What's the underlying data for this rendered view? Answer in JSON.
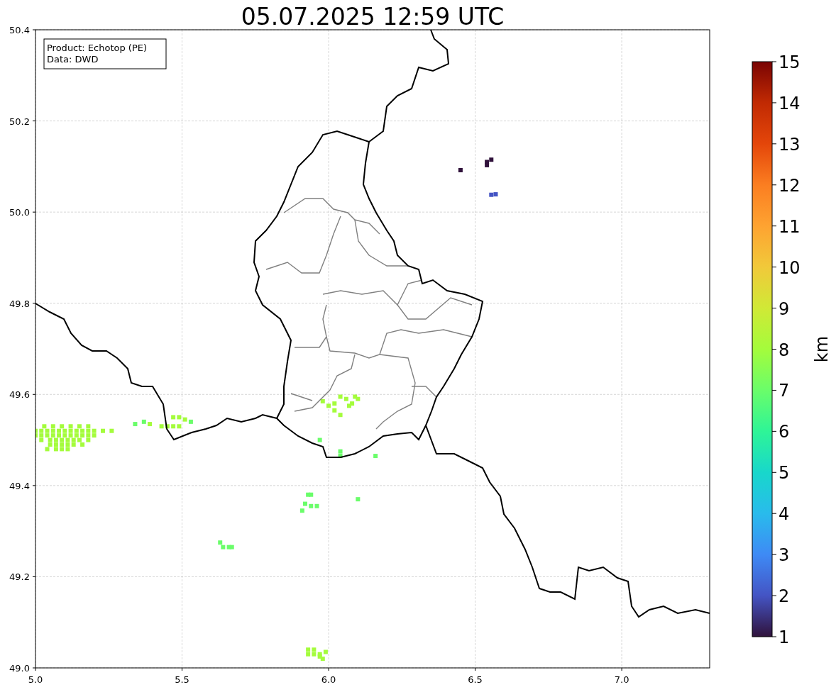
{
  "title": "05.07.2025 12:59 UTC",
  "info_box": {
    "lines": [
      "Product: Echotop (PE)",
      "Data: DWD"
    ]
  },
  "map": {
    "chart_data": {
      "type": "scatter",
      "grid": true,
      "xlim": [
        5.0,
        7.3
      ],
      "ylim": [
        49.0,
        50.4
      ],
      "xticks": [
        {
          "value": 5.0,
          "label": "5.0"
        },
        {
          "value": 5.5,
          "label": "5.5"
        },
        {
          "value": 6.0,
          "label": "6.0"
        },
        {
          "value": 6.5,
          "label": "6.5"
        },
        {
          "value": 7.0,
          "label": "7.0"
        }
      ],
      "yticks": [
        {
          "value": 49.0,
          "label": "49.0"
        },
        {
          "value": 49.2,
          "label": "49.2"
        },
        {
          "value": 49.4,
          "label": "49.4"
        },
        {
          "value": 49.6,
          "label": "49.6"
        },
        {
          "value": 49.8,
          "label": "49.8"
        },
        {
          "value": 50.0,
          "label": "50.0"
        },
        {
          "value": 50.2,
          "label": "50.2"
        },
        {
          "value": 50.4,
          "label": "50.4"
        }
      ],
      "series": [
        {
          "color": "#a4fc3c",
          "x": [
            5.03,
            5.06,
            5.09,
            5.12,
            5.15,
            5.18,
            5.0,
            5.02,
            5.04,
            5.06,
            5.08,
            5.1,
            5.12,
            5.14,
            5.16,
            5.18,
            5.2,
            5.23,
            5.26,
            5.0,
            5.02,
            5.04,
            5.06,
            5.08,
            5.1,
            5.12,
            5.14,
            5.16,
            5.18,
            5.2,
            5.02,
            5.05,
            5.07,
            5.09,
            5.11,
            5.13,
            5.15,
            5.18,
            5.05,
            5.07,
            5.09,
            5.11,
            5.13,
            5.16,
            5.04,
            5.07,
            5.09,
            5.11,
            5.39,
            5.43,
            5.45,
            5.47,
            5.49,
            5.47,
            5.51,
            5.49,
            5.98,
            6.0,
            6.02,
            6.04,
            6.04,
            6.06,
            6.08,
            6.1,
            6.07,
            6.09,
            6.02,
            5.93,
            5.95,
            5.93,
            5.95,
            5.97,
            5.98,
            5.99,
            5.97
          ],
          "values": [
            49.53,
            49.53,
            49.53,
            49.53,
            49.53,
            49.53,
            49.52,
            49.52,
            49.52,
            49.52,
            49.52,
            49.52,
            49.52,
            49.52,
            49.52,
            49.52,
            49.52,
            49.52,
            49.52,
            49.51,
            49.51,
            49.51,
            49.51,
            49.51,
            49.51,
            49.51,
            49.51,
            49.51,
            49.51,
            49.51,
            49.5,
            49.5,
            49.5,
            49.5,
            49.5,
            49.5,
            49.5,
            49.5,
            49.49,
            49.49,
            49.49,
            49.49,
            49.49,
            49.49,
            49.48,
            49.48,
            49.48,
            49.48,
            49.535,
            49.53,
            49.53,
            49.55,
            49.55,
            49.53,
            49.545,
            49.53,
            49.585,
            49.575,
            49.565,
            49.555,
            49.595,
            49.59,
            49.58,
            49.59,
            49.575,
            49.595,
            49.58,
            49.04,
            49.04,
            49.03,
            49.03,
            49.03,
            49.02,
            49.035,
            49.025
          ]
        },
        {
          "color": "#6afd6a",
          "x": [
            5.34,
            5.37,
            5.53,
            5.97,
            6.04,
            6.04,
            6.16,
            6.1,
            5.93,
            5.94,
            5.92,
            5.94,
            5.96,
            5.91,
            5.63,
            5.64,
            5.66,
            5.67
          ],
          "values": [
            49.535,
            49.54,
            49.54,
            49.5,
            49.475,
            49.465,
            49.465,
            49.37,
            49.38,
            49.38,
            49.36,
            49.355,
            49.355,
            49.345,
            49.275,
            49.265,
            49.265,
            49.265
          ]
        },
        {
          "color": "#30123b",
          "x": [
            6.45,
            6.54,
            6.555,
            6.54
          ],
          "values": [
            50.092,
            50.11,
            50.115,
            50.103
          ]
        },
        {
          "color": "#4454c4",
          "x": [
            6.555,
            6.57
          ],
          "values": [
            50.038,
            50.039
          ]
        }
      ]
    }
  },
  "colorbar": {
    "label": "km",
    "ticks": [
      "15",
      "14",
      "13",
      "12",
      "11",
      "10",
      "9",
      "8",
      "7",
      "6",
      "5",
      "4",
      "3",
      "2",
      "1"
    ]
  }
}
